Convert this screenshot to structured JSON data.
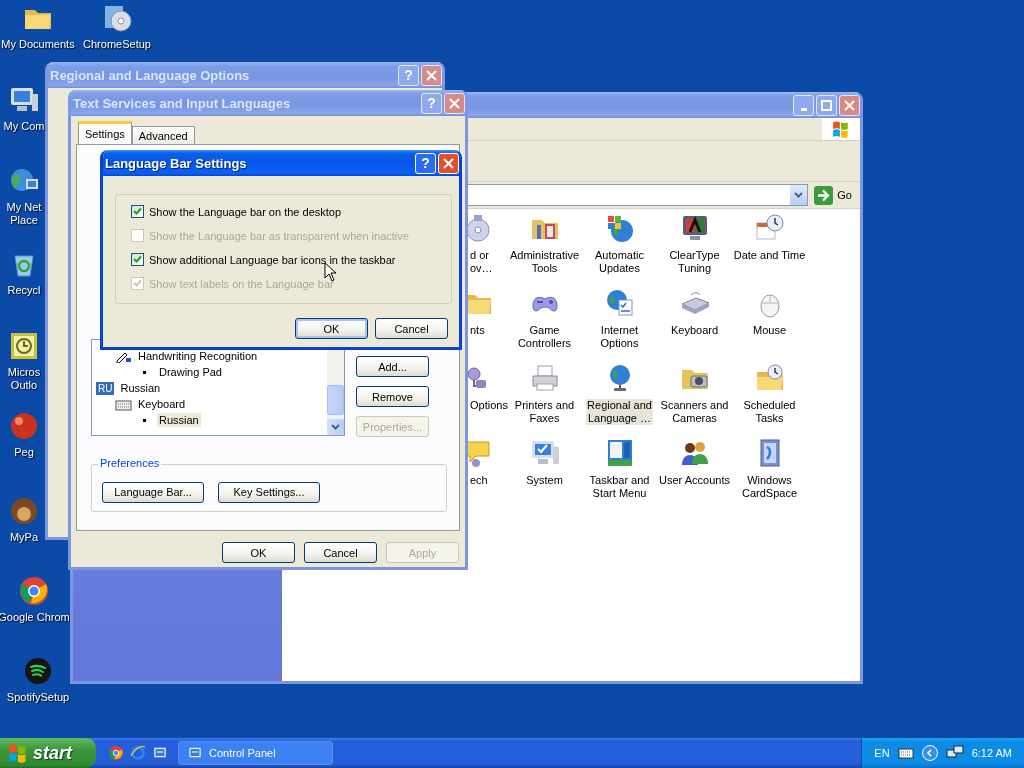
{
  "desktop_icons": [
    {
      "label": "My Documents",
      "kind": "folder"
    },
    {
      "label": "ChromeSetup",
      "kind": "cd"
    },
    {
      "label": "My Com",
      "kind": "computer"
    },
    {
      "label": "My Net\nPlace",
      "kind": "network"
    },
    {
      "label": "Recycl",
      "kind": "recycle"
    },
    {
      "label": "Micros\nOutlo",
      "kind": "outlook"
    },
    {
      "label": "Peg",
      "kind": "ball"
    },
    {
      "label": "MyPa",
      "kind": "app"
    },
    {
      "label": "Google Chrom",
      "kind": "chrome"
    },
    {
      "label": "SpotifySetup",
      "kind": "spotify"
    }
  ],
  "control_panel": {
    "active": false,
    "go": "Go",
    "items": [
      {
        "label": "d or\nov…",
        "kind": "disc",
        "selected": false
      },
      {
        "label": "Administrative\nTools",
        "kind": "tools",
        "selected": false
      },
      {
        "label": "Automatic\nUpdates",
        "kind": "winglobe",
        "selected": false
      },
      {
        "label": "ClearType\nTuning",
        "kind": "monitor",
        "selected": false
      },
      {
        "label": "Date and Time",
        "kind": "clock",
        "selected": false
      },
      {
        "label": "nts",
        "kind": "folder",
        "selected": false
      },
      {
        "label": "Game\nControllers",
        "kind": "controller",
        "selected": false
      },
      {
        "label": "Internet\nOptions",
        "kind": "globedoc",
        "selected": false
      },
      {
        "label": "Keyboard",
        "kind": "keyboard",
        "selected": false
      },
      {
        "label": "Mouse",
        "kind": "mouse",
        "selected": false
      },
      {
        "label": "Options",
        "kind": "plug",
        "selected": false
      },
      {
        "label": "Printers and\nFaxes",
        "kind": "printer",
        "selected": false
      },
      {
        "label": "Regional and\nLanguage …",
        "kind": "globestand",
        "selected": true
      },
      {
        "label": "Scanners and\nCameras",
        "kind": "camera",
        "selected": false
      },
      {
        "label": "Scheduled\nTasks",
        "kind": "folderclock",
        "selected": false
      },
      {
        "label": "ech",
        "kind": "bubble",
        "selected": false
      },
      {
        "label": "System",
        "kind": "system",
        "selected": false
      },
      {
        "label": "Taskbar and\nStart Menu",
        "kind": "taskbar",
        "selected": false
      },
      {
        "label": "User Accounts",
        "kind": "people",
        "selected": false
      },
      {
        "label": "Windows\nCardSpace",
        "kind": "card",
        "selected": false
      }
    ]
  },
  "regional_window": {
    "title": "Regional and Language Options",
    "active": false,
    "help": "?"
  },
  "text_services": {
    "title": "Text Services and Input Languages",
    "active": false,
    "help": "?",
    "tabs": [
      {
        "label": "Settings",
        "selected": true
      },
      {
        "label": "Advanced",
        "selected": false
      }
    ],
    "services": [
      {
        "label": "Handwriting Recognition",
        "kind": "handwriting",
        "selected": false,
        "children": [
          {
            "label": "Drawing Pad",
            "kind": "bullet",
            "selected": false
          }
        ]
      },
      {
        "label": "Russian",
        "kind": "language",
        "badge": "RU",
        "selected": false,
        "children": [
          {
            "label": "Keyboard",
            "kind": "keyboard",
            "selected": false,
            "children": [
              {
                "label": "Russian",
                "kind": "bullet",
                "selected": true
              }
            ]
          }
        ]
      }
    ],
    "service_buttons": [
      {
        "label": "Add...",
        "disabled": false
      },
      {
        "label": "Remove",
        "disabled": false
      },
      {
        "label": "Properties...",
        "disabled": true
      }
    ],
    "preferences": {
      "legend": "Preferences",
      "buttons": [
        "Language Bar...",
        "Key Settings..."
      ]
    },
    "buttons": [
      {
        "label": "OK",
        "disabled": false
      },
      {
        "label": "Cancel",
        "disabled": false
      },
      {
        "label": "Apply",
        "disabled": true
      }
    ]
  },
  "language_bar_settings": {
    "title": "Language Bar Settings",
    "active": true,
    "help": "?",
    "options": [
      {
        "label": "Show the Language bar on the desktop",
        "checked": true,
        "disabled": false
      },
      {
        "label": "Show the Language bar as transparent when inactive",
        "checked": false,
        "disabled": true
      },
      {
        "label": "Show additional Language bar icons in the taskbar",
        "checked": true,
        "disabled": false
      },
      {
        "label": "Show text labels on the Language bar",
        "checked": true,
        "disabled": true
      }
    ],
    "buttons": [
      {
        "label": "OK",
        "default": true
      },
      {
        "label": "Cancel",
        "default": false
      }
    ]
  },
  "taskbar": {
    "start": "start",
    "quick_launch": [
      {
        "kind": "chrome"
      },
      {
        "kind": "ie"
      },
      {
        "kind": "desktop"
      }
    ],
    "tasks": [
      {
        "label": "Control Panel",
        "selected": false
      }
    ],
    "tray": {
      "language": "EN",
      "clock": "6:12 AM"
    }
  }
}
